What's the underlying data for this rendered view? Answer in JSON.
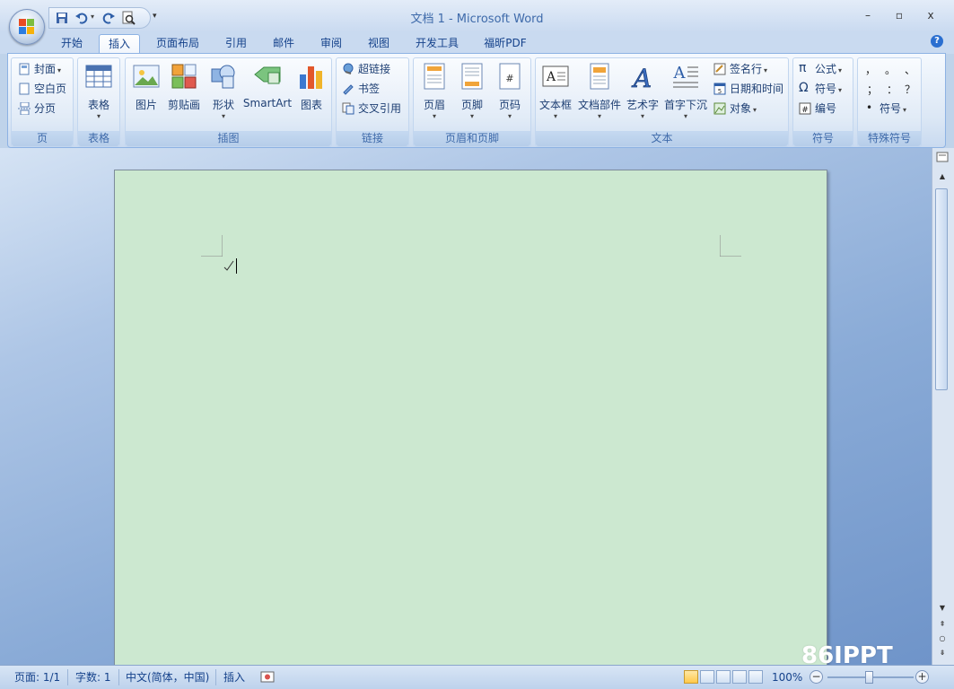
{
  "window": {
    "title": "文档 1 - Microsoft Word",
    "minimize": "–",
    "maximize": "▫",
    "close": "x"
  },
  "tabs": [
    {
      "label": "开始"
    },
    {
      "label": "插入"
    },
    {
      "label": "页面布局"
    },
    {
      "label": "引用"
    },
    {
      "label": "邮件"
    },
    {
      "label": "审阅"
    },
    {
      "label": "视图"
    },
    {
      "label": "开发工具"
    },
    {
      "label": "福昕PDF"
    }
  ],
  "active_tab": "插入",
  "help": "?",
  "groups": {
    "page": {
      "label": "页",
      "cover": "封面",
      "blank": "空白页",
      "break": "分页"
    },
    "table": {
      "label": "表格",
      "table": "表格"
    },
    "illustrations": {
      "label": "插图",
      "picture": "图片",
      "clipart": "剪贴画",
      "shapes": "形状",
      "smartart": "SmartArt",
      "chart": "图表"
    },
    "links": {
      "label": "链接",
      "hyperlink": "超链接",
      "bookmark": "书签",
      "crossref": "交叉引用"
    },
    "header_footer": {
      "label": "页眉和页脚",
      "header": "页眉",
      "footer": "页脚",
      "pagenum": "页码"
    },
    "text": {
      "label": "文本",
      "textbox": "文本框",
      "quickparts": "文档部件",
      "wordart": "艺术字",
      "dropcap": "首字下沉",
      "signature": "签名行",
      "datetime": "日期和时间",
      "object": "对象"
    },
    "symbols": {
      "label": "符号",
      "equation": "公式",
      "symbol": "符号",
      "number": "编号"
    },
    "special": {
      "label": "特殊符号",
      "chars": [
        "，",
        "。",
        "、",
        "；",
        "：",
        "？"
      ],
      "symbol": "符号"
    }
  },
  "status": {
    "page": "页面: 1/1",
    "words": "字数: 1",
    "language": "中文(简体，中国)",
    "mode": "插入",
    "zoom": "100%",
    "zoom_minus": "−",
    "zoom_plus": "+"
  },
  "watermark": "86IPPT",
  "colors": {
    "page": "#cce8d0",
    "ribbon_border": "#8db2e3",
    "text": "#15428b"
  }
}
